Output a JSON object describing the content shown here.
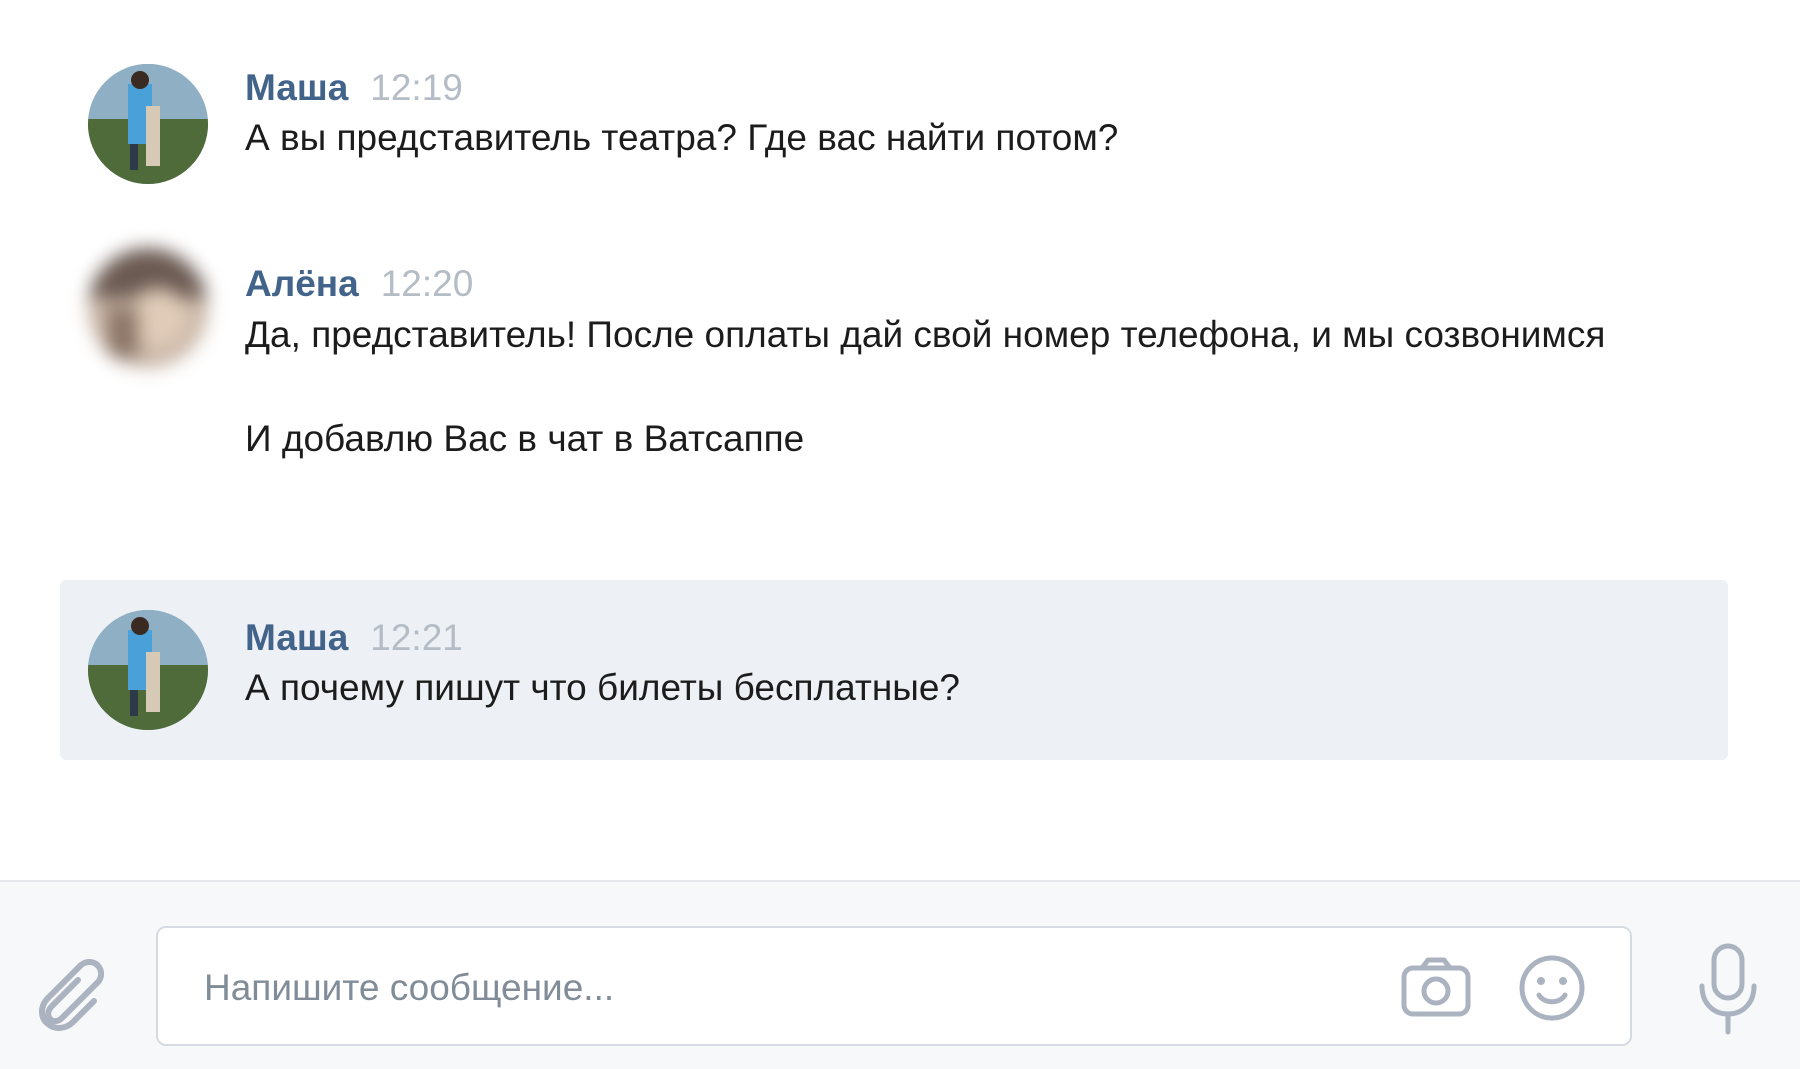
{
  "messages": [
    {
      "author": "Маша",
      "time": "12:19",
      "lines": [
        "А вы представитель театра? Где вас найти потом?"
      ],
      "highlighted": false
    },
    {
      "author": "Алёна",
      "time": "12:20",
      "lines": [
        "Да, представитель! После оплаты дай свой номер телефона, и мы созвонимся",
        "И добавлю Вас в чат в Ватсаппе"
      ],
      "highlighted": false
    },
    {
      "author": "Маша",
      "time": "12:21",
      "lines": [
        "А почему пишут что билеты бесплатные?"
      ],
      "highlighted": true
    }
  ],
  "composer": {
    "placeholder": "Напишите сообщение..."
  },
  "icons": {
    "attach": "paperclip-icon",
    "camera": "camera-icon",
    "emoji": "smile-icon",
    "voice": "microphone-icon"
  },
  "colors": {
    "author": "#42648b",
    "time": "#b4bcc6",
    "highlight": "#edf0f5",
    "icon": "#aab3bf"
  }
}
